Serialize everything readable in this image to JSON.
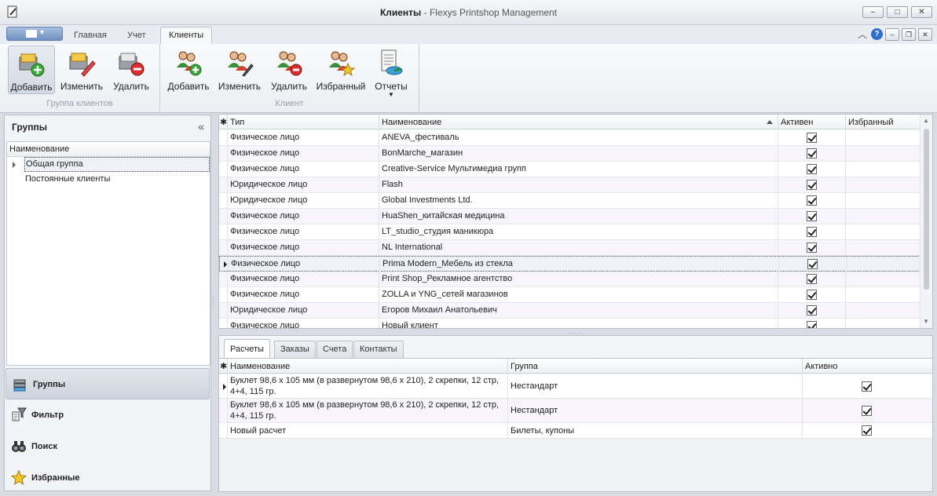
{
  "window": {
    "title_bold": "Клиенты",
    "title_rest": " - Flexys Printshop Management"
  },
  "ribbon": {
    "tabs": [
      "Главная",
      "Учет",
      "Клиенты"
    ],
    "active_tab": "Клиенты",
    "groups": [
      {
        "caption": "Группа клиентов",
        "buttons": [
          "Добавить",
          "Изменить",
          "Удалить"
        ]
      },
      {
        "caption": "Клиент",
        "buttons": [
          "Добавить",
          "Изменить",
          "Удалить",
          "Избранный",
          "Отчеты"
        ]
      }
    ]
  },
  "left_pane": {
    "title": "Группы",
    "collapse_glyph": "«",
    "tree_header": "Наименование",
    "tree_items": [
      "Общая группа",
      "Постоянные клиенты"
    ],
    "nav_items": [
      "Группы",
      "Фильтр",
      "Поиск",
      "Избранные"
    ]
  },
  "clients_grid": {
    "columns": [
      "Тип",
      "Наименование",
      "Активен",
      "Избранный"
    ],
    "rows": [
      {
        "type": "Физическое лицо",
        "name": "ANEVA_фестиваль",
        "active": true
      },
      {
        "type": "Физическое лицо",
        "name": "BonMarche_магазин",
        "active": true
      },
      {
        "type": "Физическое лицо",
        "name": "Creative-Service Мультимедиа групп",
        "active": true
      },
      {
        "type": "Юридическое лицо",
        "name": "Flash",
        "active": true
      },
      {
        "type": "Юридическое лицо",
        "name": "Global Investments Ltd.",
        "active": true
      },
      {
        "type": "Физическое лицо",
        "name": "HuaShen_китайская медицина",
        "active": true
      },
      {
        "type": "Физическое лицо",
        "name": "LT_studio_студия маникюра",
        "active": true
      },
      {
        "type": "Физическое лицо",
        "name": "NL International",
        "active": true
      },
      {
        "type": "Физическое лицо",
        "name": "Prima Modern_Мебель из стекла",
        "active": true,
        "selected": true
      },
      {
        "type": "Физическое лицо",
        "name": "Print Shop_Рекламное агентство",
        "active": true
      },
      {
        "type": "Физическое лицо",
        "name": "ZOLLA и YNG_сетей магазинов",
        "active": true
      },
      {
        "type": "Юридическое лицо",
        "name": "Егоров Михаил Анатольевич",
        "active": true
      },
      {
        "type": "Физическое лицо",
        "name": "Новый клиент",
        "active": true
      }
    ]
  },
  "detail": {
    "tabs": [
      "Расчеты",
      "Заказы",
      "Счета",
      "Контакты"
    ],
    "active_tab": "Расчеты",
    "columns": [
      "Наименование",
      "Группа",
      "Активно"
    ],
    "rows": [
      {
        "name": "Буклет 98,6 х 105 мм (в развернутом 98,6 х 210), 2 скрепки, 12 стр, 4+4, 115 гр.",
        "group": "Нестандарт",
        "active": true
      },
      {
        "name": "Буклет 98,6 х 105 мм (в развернутом 98,6 х 210), 2 скрепки, 12 стр, 4+4, 115 гр.",
        "group": "Нестандарт",
        "active": true
      },
      {
        "name": "Новый расчет",
        "group": "Билеты, купоны",
        "active": true
      }
    ]
  },
  "colors": {
    "accent": "#2e6fce",
    "selection": "#eef1f6",
    "alt_row": "#f7f5fb"
  }
}
